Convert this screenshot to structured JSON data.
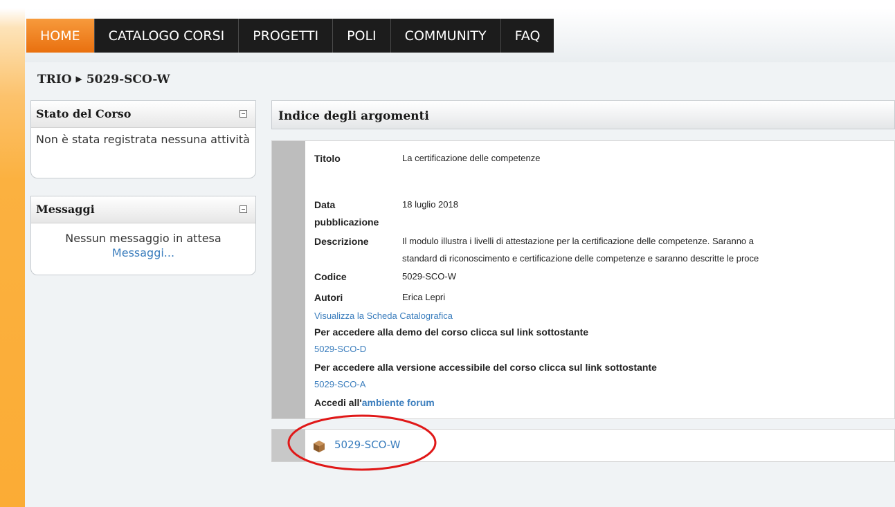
{
  "nav": {
    "items": [
      {
        "label": "HOME",
        "active": true
      },
      {
        "label": "CATALOGO CORSI",
        "active": false
      },
      {
        "label": "PROGETTI",
        "active": false
      },
      {
        "label": "POLI",
        "active": false
      },
      {
        "label": "COMMUNITY",
        "active": false
      },
      {
        "label": "FAQ",
        "active": false
      }
    ]
  },
  "breadcrumb": {
    "root": "TRIO",
    "separator": "▶",
    "current": "5029-SCO-W"
  },
  "status_block": {
    "title": "Stato del Corso",
    "text": "Non è stata registrata nessuna attività"
  },
  "messages_block": {
    "title": "Messaggi",
    "text": "Nessun messaggio in attesa",
    "link": "Messaggi..."
  },
  "main": {
    "title": "Indice degli argomenti",
    "fields": {
      "titolo_label": "Titolo",
      "titolo_value": "La certificazione delle competenze",
      "data_label_1": "Data",
      "data_label_2": "pubblicazione",
      "data_value": "18 luglio 2018",
      "descrizione_label": "Descrizione",
      "descrizione_line1": "Il modulo illustra i livelli di attestazione per la certificazione delle competenze. Saranno a",
      "descrizione_line2": "standard di riconoscimento e certificazione delle competenze e saranno descritte le proce",
      "codice_label": "Codice",
      "codice_value": "5029-SCO-W",
      "autori_label": "Autori",
      "autori_value": "Erica Lepri"
    },
    "scheda_link": "Visualizza la Scheda Catalografica",
    "demo_text": "Per accedere alla demo del corso clicca sul link sottostante",
    "demo_link": "5029-SCO-D",
    "accessible_text": "Per accedere alla versione accessibile del corso clicca sul link sottostante",
    "accessible_link": "5029-SCO-A",
    "forum_prefix": "Accedi all'",
    "forum_link": "ambiente forum"
  },
  "sco": {
    "icon": "package-icon",
    "link": "5029-SCO-W"
  },
  "colors": {
    "accent_orange": "#f08a24",
    "nav_dark": "#1c1c1c",
    "link_blue": "#3a7dbd",
    "highlight_red": "#e01818"
  }
}
